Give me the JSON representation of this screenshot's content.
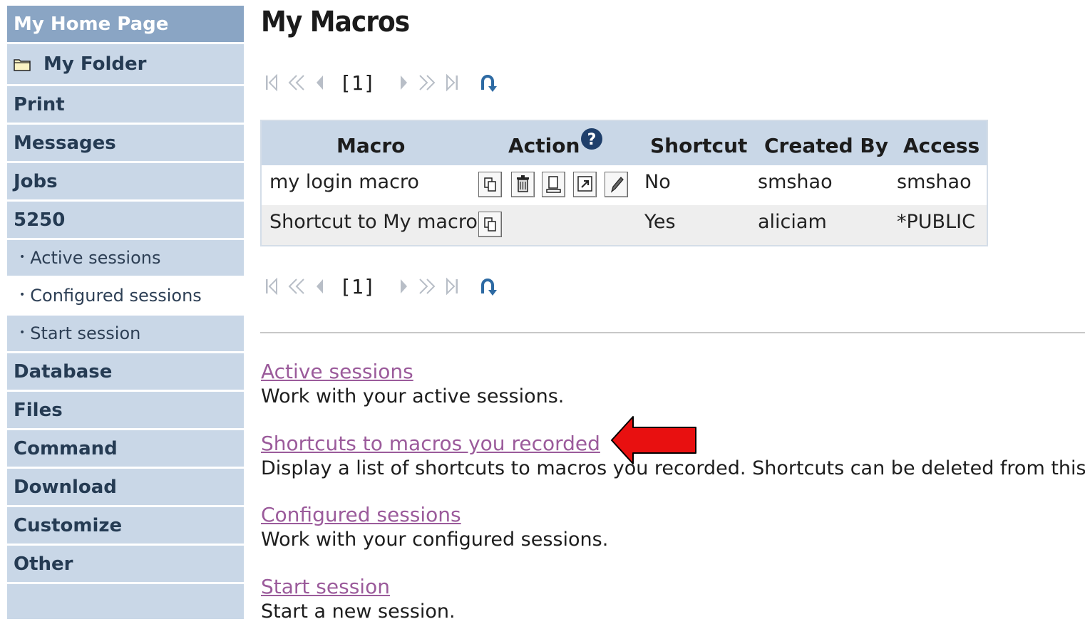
{
  "sidebar": {
    "home": "My Home Page",
    "folder": "My Folder",
    "items": [
      "Print",
      "Messages",
      "Jobs",
      "5250"
    ],
    "sub_items": [
      "Active sessions",
      "Configured sessions",
      "Start session"
    ],
    "items_after": [
      "Database",
      "Files",
      "Command",
      "Download",
      "Customize",
      "Other"
    ]
  },
  "main": {
    "title": "My Macros",
    "pager": {
      "page": "[1]"
    },
    "table": {
      "headers": {
        "macro": "Macro",
        "action": "Action",
        "shortcut": "Shortcut",
        "created_by": "Created By",
        "access": "Access"
      },
      "rows": [
        {
          "macro": "my login macro",
          "shortcut": "No",
          "created_by": "smshao",
          "access": "smshao"
        },
        {
          "macro": "Shortcut to My macro",
          "shortcut": "Yes",
          "created_by": "aliciam",
          "access": "*PUBLIC"
        }
      ]
    },
    "links": [
      {
        "label": "Active sessions",
        "desc": "Work with your active sessions."
      },
      {
        "label": "Shortcuts to macros you recorded",
        "desc": "Display a list of shortcuts to macros you recorded. Shortcuts can be deleted from this list."
      },
      {
        "label": "Configured sessions",
        "desc": "Work with your configured sessions."
      },
      {
        "label": "Start session",
        "desc": "Start a new session."
      }
    ]
  },
  "colors": {
    "nav_bg": "#c9d7e7",
    "nav_home": "#8aa5c4",
    "nav_text": "#253b53",
    "link": "#9b5b9b",
    "arrow": "#e81010"
  }
}
